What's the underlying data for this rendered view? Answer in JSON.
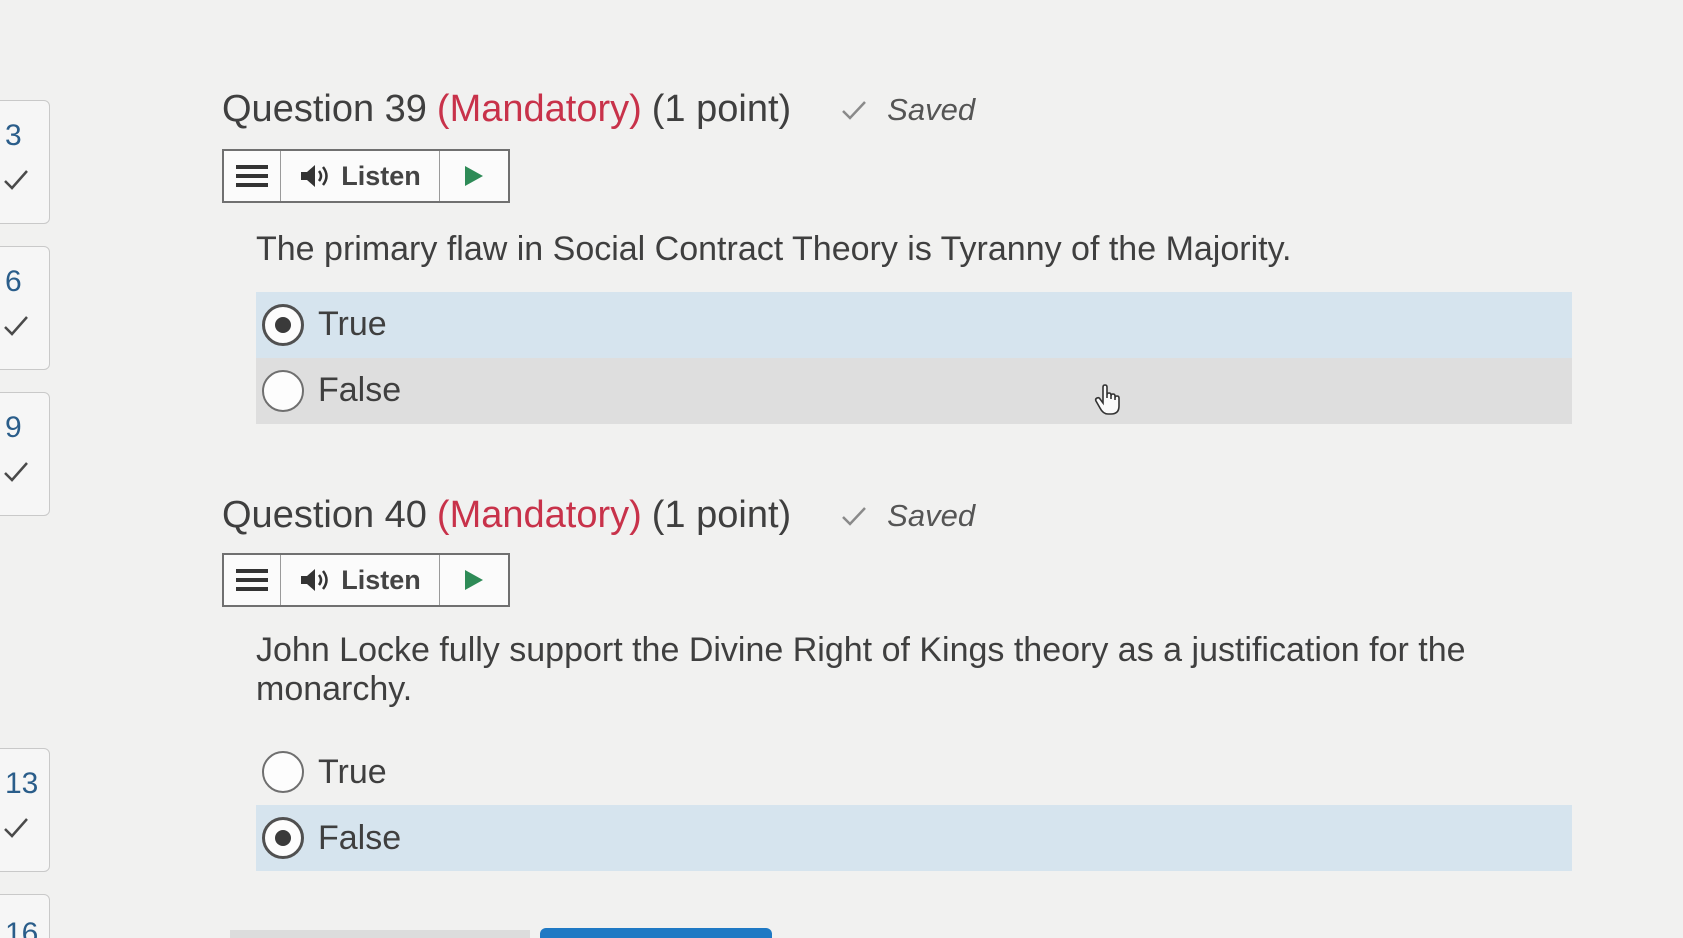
{
  "nav": [
    {
      "number": "3",
      "answered": true
    },
    {
      "number": "6",
      "answered": true
    },
    {
      "number": "9",
      "answered": true
    },
    {
      "number": "13",
      "answered": true
    },
    {
      "number": "16",
      "answered": false
    }
  ],
  "questions": [
    {
      "title": "Question 39",
      "mandatory": "(Mandatory)",
      "points": "(1 point)",
      "status": "Saved",
      "listen_label": "Listen",
      "text": "The primary flaw in Social Contract Theory is Tyranny of the Majority.",
      "options": [
        {
          "label": "True",
          "selected": true
        },
        {
          "label": "False",
          "selected": false
        }
      ]
    },
    {
      "title": "Question 40",
      "mandatory": "(Mandatory)",
      "points": "(1 point)",
      "status": "Saved",
      "listen_label": "Listen",
      "text": "John Locke fully support the Divine Right of Kings theory as a justification for the monarchy.",
      "options": [
        {
          "label": "True",
          "selected": false
        },
        {
          "label": "False",
          "selected": true
        }
      ]
    }
  ],
  "colors": {
    "mandatory": "#c8324a",
    "selected_option_bg": "#d6e4ee",
    "nav_number": "#2a5d8a",
    "bottom_button": "#1f79c4"
  },
  "icons": {
    "menu": "menu-icon",
    "listen": "speaker-icon",
    "play": "play-icon",
    "saved": "checkmark-icon",
    "cursor": "hand-pointer-icon"
  }
}
